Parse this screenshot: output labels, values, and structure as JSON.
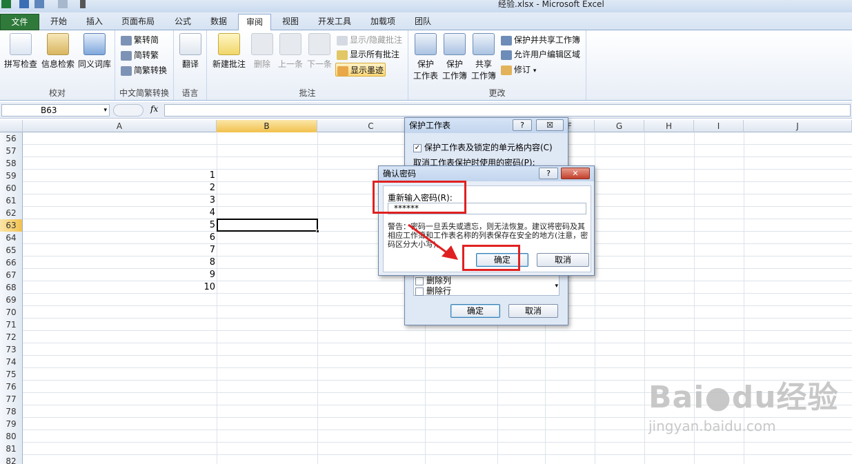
{
  "window": {
    "title": "经验.xlsx - Microsoft Excel"
  },
  "tabs": [
    "文件",
    "开始",
    "插入",
    "页面布局",
    "公式",
    "数据",
    "审阅",
    "视图",
    "开发工具",
    "加载项",
    "团队"
  ],
  "ribbon": {
    "proofing": {
      "label": "校对",
      "spell": "拼写检查",
      "research": "信息检索",
      "thesaurus": "同义词库"
    },
    "chinese": {
      "label": "中文简繁转换",
      "t2s": "繁转简",
      "s2t": "简转繁",
      "convert": "简繁转换"
    },
    "language": {
      "label": "语言",
      "translate": "翻译"
    },
    "comments": {
      "label": "批注",
      "new": "新建批注",
      "delete": "删除",
      "prev": "上一条",
      "next": "下一条",
      "showhide": "显示/隐藏批注",
      "showall": "显示所有批注",
      "ink": "显示墨迹"
    },
    "changes": {
      "label": "更改",
      "protect_sheet": [
        "保护",
        "工作表"
      ],
      "protect_book": [
        "保护",
        "工作簿"
      ],
      "share_book": [
        "共享",
        "工作簿"
      ],
      "protect_share": "保护并共享工作簿",
      "allow_edit": "允许用户编辑区域",
      "track": "修订"
    }
  },
  "formula": {
    "namebox": "B63",
    "fx": "fx",
    "value": ""
  },
  "columns": [
    "A",
    "B",
    "C",
    "D",
    "E",
    "F",
    "G",
    "H",
    "I",
    "J"
  ],
  "rows": [
    {
      "n": "56",
      "a": ""
    },
    {
      "n": "57",
      "a": ""
    },
    {
      "n": "58",
      "a": ""
    },
    {
      "n": "59",
      "a": "1"
    },
    {
      "n": "60",
      "a": "2"
    },
    {
      "n": "61",
      "a": "3"
    },
    {
      "n": "62",
      "a": "4"
    },
    {
      "n": "63",
      "a": "5"
    },
    {
      "n": "64",
      "a": "6"
    },
    {
      "n": "65",
      "a": "7"
    },
    {
      "n": "66",
      "a": "8"
    },
    {
      "n": "67",
      "a": "9"
    },
    {
      "n": "68",
      "a": "10"
    },
    {
      "n": "69",
      "a": ""
    },
    {
      "n": "70",
      "a": ""
    },
    {
      "n": "71",
      "a": ""
    },
    {
      "n": "72",
      "a": ""
    },
    {
      "n": "73",
      "a": ""
    },
    {
      "n": "74",
      "a": ""
    },
    {
      "n": "75",
      "a": ""
    },
    {
      "n": "76",
      "a": ""
    },
    {
      "n": "77",
      "a": ""
    },
    {
      "n": "78",
      "a": ""
    },
    {
      "n": "79",
      "a": ""
    },
    {
      "n": "80",
      "a": ""
    },
    {
      "n": "81",
      "a": ""
    },
    {
      "n": "82",
      "a": ""
    }
  ],
  "protect_dialog": {
    "title": "保护工作表",
    "help": "?",
    "close": "☒",
    "checkbox_label": "保护工作表及锁定的单元格内容(C)",
    "checked": true,
    "password_label": "取消工作表保护时使用的密码(P):",
    "list_items": [
      "删除列",
      "删除行"
    ],
    "ok": "确定",
    "cancel": "取消"
  },
  "confirm_dialog": {
    "title": "确认密码",
    "help": "?",
    "close": "✕",
    "reenter_label": "重新输入密码(R):",
    "password_value": "******",
    "warning": "警告：密码一旦丢失或遗忘，则无法恢复。建议将密码及其相应工作簿和工作表名称的列表保存在安全的地方(注意，密码区分大小写)。",
    "ok": "确定",
    "cancel": "取消"
  },
  "watermark": {
    "brand": "Bai",
    "brand2": "du",
    "product": "经验",
    "url": "jingyan.baidu.com"
  },
  "colors": {
    "accent_red": "#e02020",
    "file_tab": "#2f7a3a",
    "selected_header": "#f2c14e"
  }
}
